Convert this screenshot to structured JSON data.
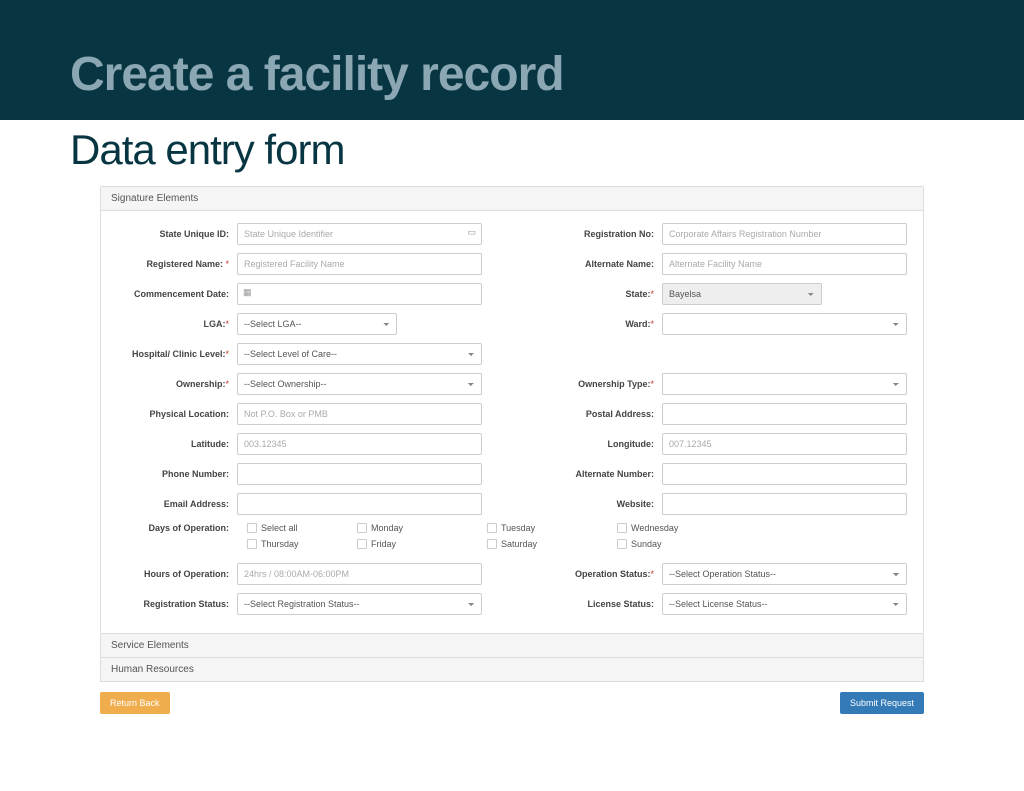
{
  "hero": {
    "title": "Create a facility record",
    "subtitle": "Data entry form"
  },
  "sections": {
    "signature": "Signature Elements",
    "service": "Service Elements",
    "human": "Human Resources"
  },
  "labels": {
    "stateUniqueId": "State Unique ID:",
    "registrationNo": "Registration No:",
    "registeredName": "Registered Name:",
    "alternateName": "Alternate Name:",
    "commencementDate": "Commencement Date:",
    "state": "State:",
    "lga": "LGA:",
    "ward": "Ward:",
    "hospitalLevel": "Hospital/ Clinic Level:",
    "ownership": "Ownership:",
    "ownershipType": "Ownership Type:",
    "physicalLocation": "Physical Location:",
    "postalAddress": "Postal Address:",
    "latitude": "Latitude:",
    "longitude": "Longitude:",
    "phoneNumber": "Phone Number:",
    "alternateNumber": "Alternate Number:",
    "emailAddress": "Email Address:",
    "website": "Website:",
    "daysOfOperation": "Days of Operation:",
    "hoursOfOperation": "Hours of Operation:",
    "operationStatus": "Operation Status:",
    "registrationStatus": "Registration Status:",
    "licenseStatus": "License Status:"
  },
  "placeholders": {
    "stateUniqueId": "State Unique Identifier",
    "registrationNo": "Corporate Affairs Registration Number",
    "registeredName": "Registered Facility Name",
    "alternateName": "Alternate Facility Name",
    "physicalLocation": "Not P.O. Box or PMB",
    "latitude": "003.12345",
    "longitude": "007.12345",
    "hoursOfOperation": "24hrs / 08:00AM-06:00PM"
  },
  "options": {
    "state": "Bayelsa",
    "lga": "--Select LGA--",
    "ward": "",
    "hospitalLevel": "--Select Level of Care--",
    "ownership": "--Select Ownership--",
    "ownershipType": "",
    "operationStatus": "--Select Operation Status--",
    "registrationStatus": "--Select Registration Status--",
    "licenseStatus": "--Select License Status--"
  },
  "days": {
    "selectAll": "Select all",
    "mon": "Monday",
    "tue": "Tuesday",
    "wed": "Wednesday",
    "thu": "Thursday",
    "fri": "Friday",
    "sat": "Saturday",
    "sun": "Sunday"
  },
  "buttons": {
    "return": "Return Back",
    "submit": "Submit Request"
  },
  "required": "*"
}
